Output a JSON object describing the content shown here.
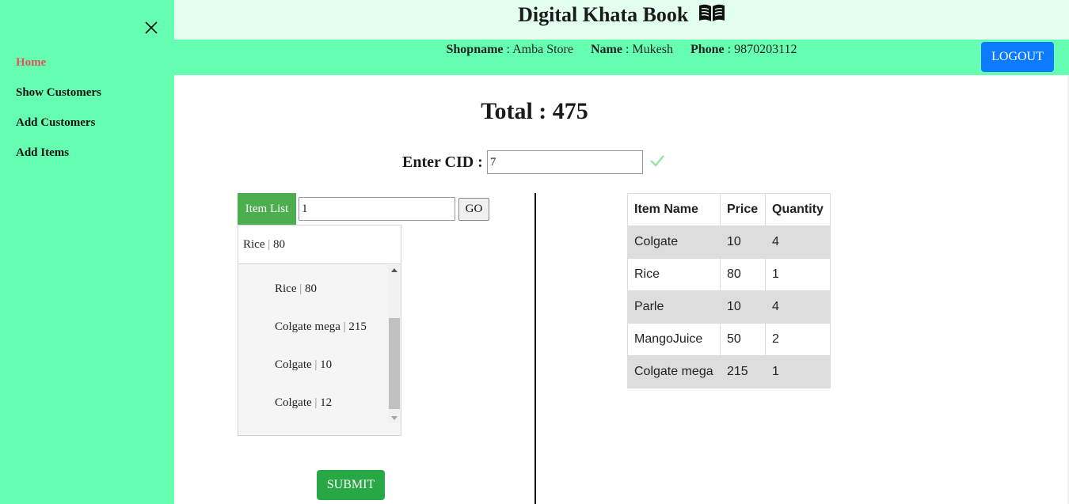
{
  "app": {
    "title": "Digital Khata Book",
    "title_icon": "book-open-icon"
  },
  "sidebar": {
    "close_icon": "close-icon",
    "items": [
      {
        "label": "Home",
        "active": true
      },
      {
        "label": "Show Customers",
        "active": false
      },
      {
        "label": "Add Customers",
        "active": false
      },
      {
        "label": "Add Items",
        "active": false
      }
    ]
  },
  "info": {
    "shopname_label": "Shopname",
    "shopname_value": " : Amba Store",
    "name_label": "Name",
    "name_value": " : Mukesh",
    "phone_label": "Phone",
    "phone_value": " : 9870203112",
    "logout_label": "LOGOUT"
  },
  "summary": {
    "total_text": "Total : 475"
  },
  "cid": {
    "label": "Enter CID :",
    "value": "7",
    "status_icon": "checkmark-icon"
  },
  "item_search": {
    "tab_label": "Item List",
    "value": "1",
    "go_label": "GO",
    "selected": {
      "name": "Rice",
      "price": "80"
    },
    "options": [
      {
        "name": "Rice",
        "price": "80"
      },
      {
        "name": "Colgate mega",
        "price": "215"
      },
      {
        "name": "Colgate",
        "price": "10"
      },
      {
        "name": "Colgate",
        "price": "12"
      }
    ],
    "separator": " | "
  },
  "submit_label": "SUBMIT",
  "items_table": {
    "headers": [
      "Item Name",
      "Price",
      "Quantity"
    ],
    "rows": [
      [
        "Colgate",
        "10",
        "4"
      ],
      [
        "Rice",
        "80",
        "1"
      ],
      [
        "Parle",
        "10",
        "4"
      ],
      [
        "MangoJuice",
        "50",
        "2"
      ],
      [
        "Colgate mega",
        "215",
        "1"
      ]
    ]
  },
  "colors": {
    "sidebar_bg": "#66ffb2",
    "topbar_bg": "#e3fff0",
    "active_nav": "#e0555b",
    "logout_bg": "#0d7bff",
    "submit_bg": "#28a745",
    "tab_bg": "#4cae4f"
  }
}
